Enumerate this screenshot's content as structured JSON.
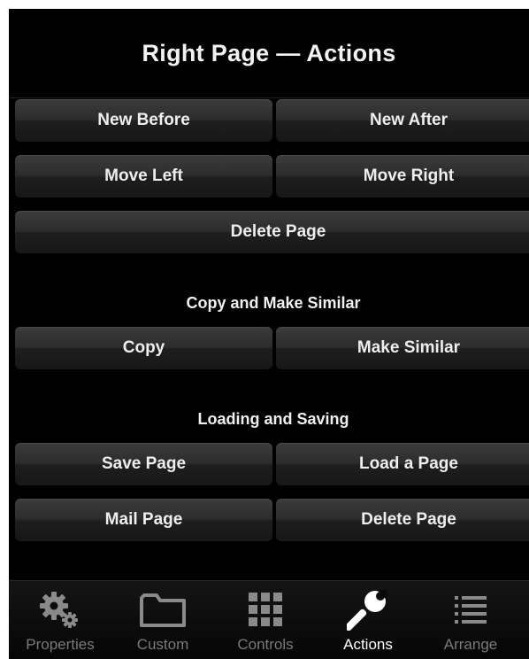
{
  "header": {
    "title": "Right Page — Actions"
  },
  "page_buttons": {
    "new_before": "New Before",
    "new_after": "New After",
    "move_left": "Move Left",
    "move_right": "Move Right",
    "delete_page": "Delete Page"
  },
  "copy_section": {
    "title": "Copy and Make Similar",
    "copy": "Copy",
    "make_similar": "Make Similar"
  },
  "loading_section": {
    "title": "Loading and Saving",
    "save_page": "Save Page",
    "load_page": "Load a Page",
    "mail_page": "Mail Page",
    "delete_page": "Delete Page"
  },
  "tabs": [
    {
      "label": "Properties",
      "icon": "gears-icon",
      "active": false
    },
    {
      "label": "Custom",
      "icon": "folder-icon",
      "active": false
    },
    {
      "label": "Controls",
      "icon": "grid-icon",
      "active": false
    },
    {
      "label": "Actions",
      "icon": "wrench-icon",
      "active": true
    },
    {
      "label": "Arrange",
      "icon": "list-icon",
      "active": false
    }
  ],
  "colors": {
    "background": "#000000",
    "button": "#2c2c2c",
    "text": "#eeeeee",
    "tab_inactive": "#7a7a7a",
    "tab_active": "#ffffff"
  }
}
